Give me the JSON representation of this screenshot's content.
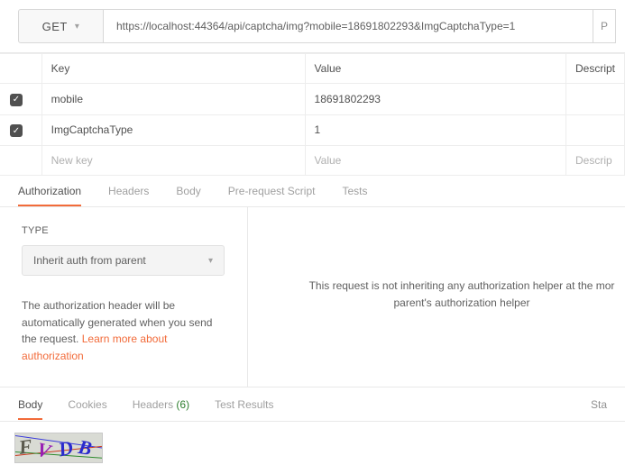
{
  "request": {
    "method": "GET",
    "url": "https://localhost:44364/api/captcha/img?mobile=18691802293&ImgCaptchaType=1",
    "send_hint": "P"
  },
  "params": {
    "headers": {
      "key": "Key",
      "value": "Value",
      "description": "Descript"
    },
    "rows": [
      {
        "checked": true,
        "key": "mobile",
        "value": "18691802293"
      },
      {
        "checked": true,
        "key": "ImgCaptchaType",
        "value": "1"
      }
    ],
    "placeholder": {
      "key": "New key",
      "value": "Value",
      "description": "Descrip"
    }
  },
  "request_tabs": {
    "items": [
      {
        "label": "Authorization",
        "active": true
      },
      {
        "label": "Headers",
        "active": false
      },
      {
        "label": "Body",
        "active": false
      },
      {
        "label": "Pre-request Script",
        "active": false
      },
      {
        "label": "Tests",
        "active": false
      }
    ]
  },
  "auth": {
    "type_label": "TYPE",
    "selected": "Inherit auth from parent",
    "help_prefix": "The authorization header will be automatically generated when you send the request. ",
    "help_link": "Learn more about authorization",
    "right_line1": "This request is not inheriting any authorization helper at the mor",
    "right_line2": "parent's authorization helper"
  },
  "response_tabs": {
    "items": [
      {
        "label": "Body",
        "active": true,
        "count": null
      },
      {
        "label": "Cookies",
        "active": false,
        "count": null
      },
      {
        "label": "Headers",
        "active": false,
        "count": "(6)"
      },
      {
        "label": "Test Results",
        "active": false,
        "count": null
      }
    ],
    "status_hint": "Sta"
  },
  "captcha": {
    "chars": [
      "F",
      "V",
      "D",
      "B"
    ],
    "colors": {
      "F": "#5b5a4e",
      "V": "#991fb3",
      "D": "#2a2acd",
      "B": "#2a2acd"
    }
  }
}
